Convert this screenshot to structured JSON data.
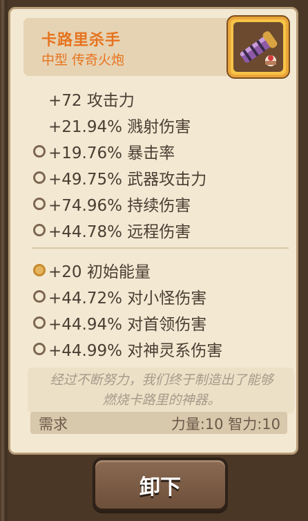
{
  "item": {
    "name": "卡路里杀手",
    "type": "中型 传奇火炮",
    "icon": "cannon-icon"
  },
  "stats": [
    {
      "text": "+72 攻击力",
      "bullet": false
    },
    {
      "text": "+21.94% 溅射伤害",
      "bullet": false
    },
    {
      "text": "+19.76% 暴击率",
      "bullet": true
    },
    {
      "text": "+49.75% 武器攻击力",
      "bullet": true
    },
    {
      "text": "+74.96% 持续伤害",
      "bullet": true
    },
    {
      "text": "+44.78% 远程伤害",
      "bullet": true
    }
  ],
  "special_stats": [
    {
      "text": "+20 初始能量",
      "bullet": "gold"
    },
    {
      "text": "+44.72% 对小怪伤害",
      "bullet": true
    },
    {
      "text": "+44.94% 对首领伤害",
      "bullet": true
    },
    {
      "text": "+44.99% 对神灵系伤害",
      "bullet": true
    }
  ],
  "description_line1": "经过不断努力，我们终于制造出了能够",
  "description_line2": "燃烧卡路里的神器。",
  "requirements": {
    "label": "需求",
    "values": "力量:10 智力:10"
  },
  "button": {
    "label": "卸下"
  },
  "colors": {
    "title": "#e6731f",
    "text": "#4a3d32",
    "panel": "#f3e8d2",
    "button": "#7a5b45"
  }
}
